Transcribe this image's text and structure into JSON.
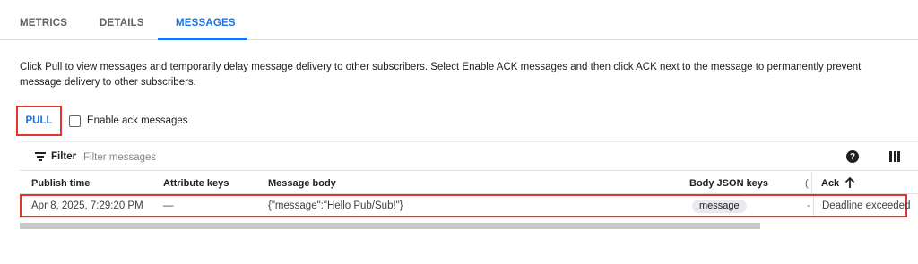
{
  "tabs": [
    {
      "label": "METRICS",
      "active": false
    },
    {
      "label": "DETAILS",
      "active": false
    },
    {
      "label": "MESSAGES",
      "active": true
    }
  ],
  "description": "Click Pull to view messages and temporarily delay message delivery to other subscribers. Select Enable ACK messages and then click ACK next to the message to permanently prevent message delivery to other subscribers.",
  "actions": {
    "pull_label": "PULL",
    "enable_ack_label": "Enable ack messages",
    "enable_ack_checked": false
  },
  "filter": {
    "label": "Filter",
    "placeholder": "Filter messages",
    "help_icon": "help-icon",
    "columns_icon": "column-display-icon"
  },
  "table": {
    "columns": [
      "Publish time",
      "Attribute keys",
      "Message body",
      "Body JSON keys",
      "Ack"
    ],
    "sort_indicator": "arrow-up-icon",
    "rows": [
      {
        "publish_time": "Apr 8, 2025, 7:29:20 PM",
        "attribute_keys": "—",
        "message_body": "{\"message\":\"Hello Pub/Sub!\"}",
        "body_json_keys": "message",
        "ack": "Deadline exceeded"
      }
    ]
  },
  "colors": {
    "accent": "#1a73e8",
    "highlight_border": "#e3342f",
    "chip_bg": "#e8eaed"
  }
}
